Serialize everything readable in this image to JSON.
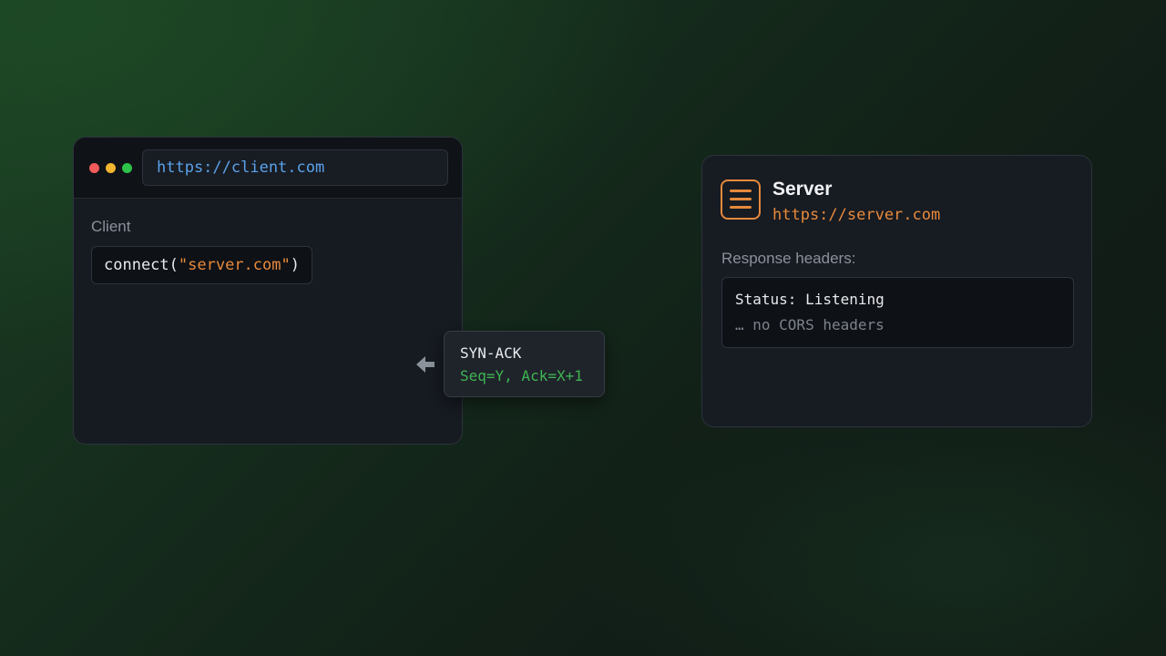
{
  "client": {
    "url": "https://client.com",
    "label": "Client",
    "code": {
      "fn_open": "connect(",
      "arg": "\"server.com\"",
      "fn_close": ")"
    }
  },
  "packet": {
    "direction_icon": "arrow-left-icon",
    "title": "SYN-ACK",
    "fields": "Seq=Y, Ack=X+1"
  },
  "server": {
    "icon": "server-icon",
    "title": "Server",
    "url": "https://server.com",
    "response_label": "Response headers:",
    "status_line": "Status: Listening",
    "note": "… no CORS headers"
  },
  "colors": {
    "client_url": "#5aa2ea",
    "accent_orange": "#e88a3c",
    "packet_green": "#3fb452"
  }
}
